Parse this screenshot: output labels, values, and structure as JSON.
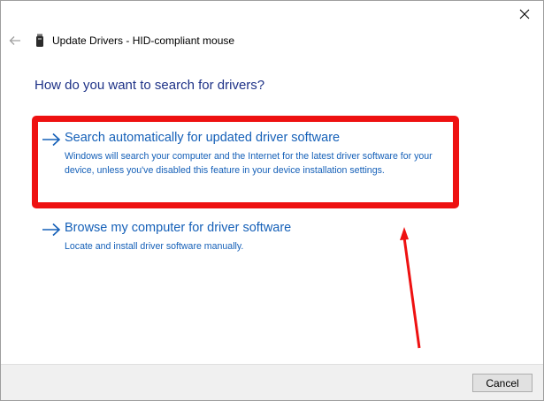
{
  "window": {
    "title": "Update Drivers - HID-compliant mouse",
    "close_icon": "close-icon",
    "back_icon": "back-arrow-icon",
    "title_icon": "device-icon"
  },
  "heading": "How do you want to search for drivers?",
  "options": [
    {
      "title": "Search automatically for updated driver software",
      "description": "Windows will search your computer and the Internet for the latest driver software for your device, unless you've disabled this feature in your device installation settings.",
      "icon": "arrow-right-icon"
    },
    {
      "title": "Browse my computer for driver software",
      "description": "Locate and install driver software manually.",
      "icon": "arrow-right-icon"
    }
  ],
  "footer": {
    "cancel_label": "Cancel"
  },
  "colors": {
    "heading": "#1e3287",
    "link": "#1560b8",
    "annotation": "#ee1111",
    "footer_bg": "#f0f0f0"
  }
}
